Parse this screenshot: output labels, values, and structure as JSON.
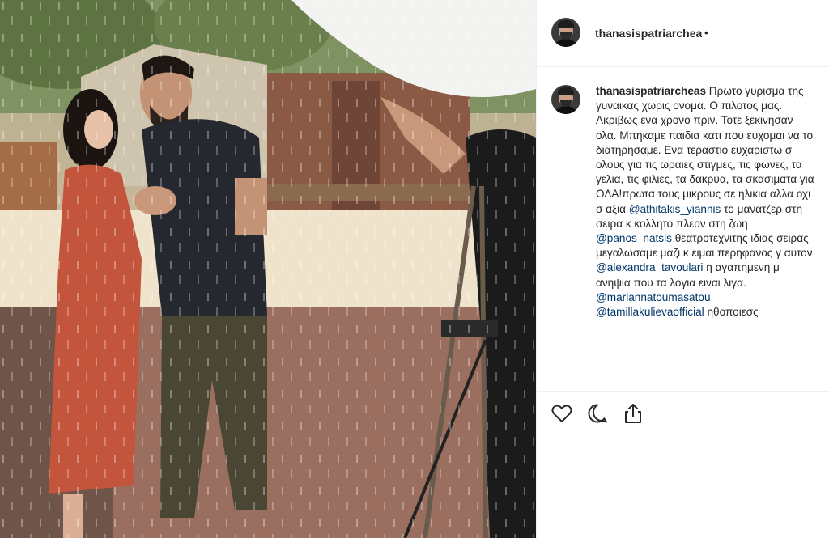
{
  "post": {
    "username": "thanasispatriarcheas",
    "follow_dot": "•",
    "caption": {
      "username": "thanasispatriarcheas",
      "text_1": "Πρωτο γυρισμα της γυναικας χωρις ονομα. Ο πιλοτος μας. Ακριβως ενα χρονο πριν. Τοτε ξεκινησαν ολα. Μπηκαμε παιδια κατι που ευχομαι να το διατηρησαμε. Ενα τεραστιο ευχαριστω σ ολους για τις ωραιες στιγμες, τις φωνες, τα γελια, τις φιλιες, τα δακρυα, τα σκασιματα για ΟΛΑ!πρωτα τους μικρους σε ηλικια αλλα οχι σ αξια",
      "mention_1": "@athitakis_yiannis",
      "text_2": "το μανατζερ στη σειρα κ κολλητο πλεον στη ζωη",
      "mention_2": "@panos_natsis",
      "text_3": "θεατροτεχνιτης ιδιας σειρας μεγαλωσαμε μαζι κ ειμαι περηφανος γ αυτον",
      "mention_3": "@alexandra_tavoulari",
      "text_4": "η αγαπημενη μ ανηψια που τα λογια ειναι λιγα.",
      "mention_4": "@mariannatoumasatou",
      "mention_5": "@tamillakulievaofficial",
      "text_5": "ηθοποιεσς"
    }
  },
  "icons": {
    "like": "heart-icon",
    "comment": "comment-icon",
    "share": "share-icon"
  },
  "colors": {
    "mention": "#003569",
    "text": "#262626",
    "divider": "#efefef"
  }
}
